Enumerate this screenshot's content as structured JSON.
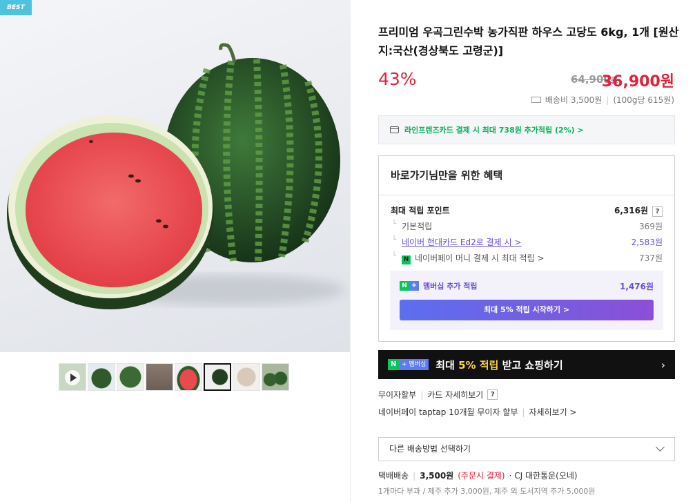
{
  "gallery": {
    "badge": "BEST",
    "thumbnails": [
      "video",
      "photo-2",
      "photo-3",
      "photo-4",
      "photo-5",
      "photo-6",
      "photo-7",
      "photo-8"
    ],
    "active_thumbnail": 5
  },
  "product": {
    "title": "프리미엄 우곡그린수박 농가직판 하우스 고당도 6kg, 1개 [원산지:국산(경상북도 고령군)]",
    "discount": "43%",
    "original_price": "64,900",
    "original_price_unit": "원",
    "price": "36,900원",
    "shipping_fee": "배송비 3,500원",
    "unit_price": "(100g당 615원)"
  },
  "card_promo": {
    "text": "라인프렌즈카드 결제 시 최대 738원 추가적립 (2%) >"
  },
  "benefit": {
    "title": "바로가기님만을 위한 혜택",
    "max_points_label": "최대 적립 포인트",
    "max_points_value": "6,316원",
    "help": "?",
    "rows": [
      {
        "label": "기본적립",
        "value": "369원"
      },
      {
        "label": "네이버 현대카드 Ed2로 결제 시 >",
        "value": "2,583원"
      },
      {
        "label": "네이버페이 머니 결제 시 최대 적립 >",
        "value": "737원"
      }
    ],
    "npay_icon": "N",
    "membership_label": "멤버십 추가 적립",
    "membership_value": "1,476원",
    "membership_n": "N",
    "membership_plus": "+",
    "start_button": "최대 5% 적립 시작하기 >"
  },
  "banner": {
    "tag_n": "N",
    "tag_text": "+ 멤버십",
    "text_pre": "최대 ",
    "text_highlight": "5% 적립",
    "text_post": " 받고 쇼핑하기",
    "chevron": "›"
  },
  "installment": {
    "label": "무이자할부",
    "card_detail": "카드 자세히보기",
    "help": "?",
    "naverpay": "네이버페이 taptap 10개월 무이자 할부",
    "detail": "자세히보기 >"
  },
  "shipping": {
    "select_label": "다른 배송방법 선택하기",
    "method": "택배배송",
    "fee": "3,500원",
    "pay_note": "(주문시 결제)",
    "carrier": "· CJ 대한통운(오네)",
    "note": "1개마다 부과 / 제주 추가 3,000원, 제주 외 도서지역 추가 5,000원"
  }
}
